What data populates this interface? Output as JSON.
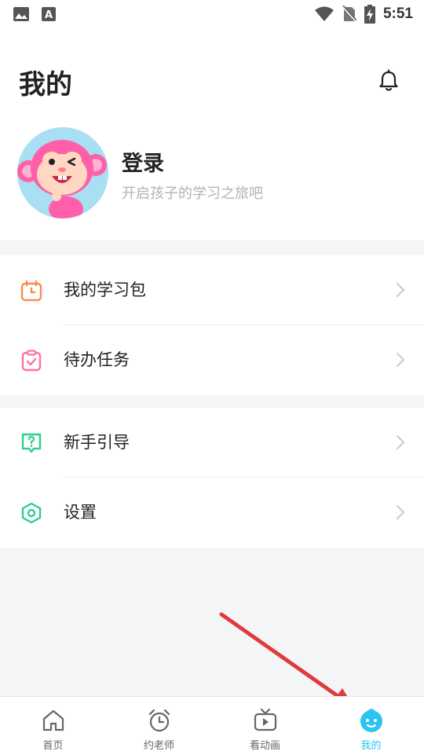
{
  "status_bar": {
    "time": "5:51",
    "left_icons": [
      "image-icon",
      "text-a-icon"
    ],
    "right_icons": [
      "wifi-icon",
      "no-sim-icon",
      "battery-charging-icon"
    ]
  },
  "header": {
    "title": "我的",
    "bell_icon": "bell-icon"
  },
  "profile": {
    "avatar": "monkey-avatar",
    "login_label": "登录",
    "subtitle": "开启孩子的学习之旅吧"
  },
  "menu_groups": [
    {
      "items": [
        {
          "label": "我的学习包",
          "icon": "calendar-clock-icon",
          "color": "#ff8a4c"
        },
        {
          "label": "待办任务",
          "icon": "clipboard-check-icon",
          "color": "#ff6fa3"
        }
      ]
    },
    {
      "items": [
        {
          "label": "新手引导",
          "icon": "help-chat-icon",
          "color": "#2ecf8e"
        },
        {
          "label": "设置",
          "icon": "settings-hexagon-icon",
          "color": "#2ecf8e"
        }
      ]
    }
  ],
  "tabbar": {
    "tabs": [
      {
        "label": "首页",
        "icon": "home-icon",
        "active": false
      },
      {
        "label": "约老师",
        "icon": "alarm-clock-icon",
        "active": false
      },
      {
        "label": "看动画",
        "icon": "tv-play-icon",
        "active": false
      },
      {
        "label": "我的",
        "icon": "baby-face-icon",
        "active": true
      }
    ],
    "active_color": "#2cc4f2",
    "inactive_color": "#666666"
  },
  "annotation": {
    "arrow_color": "#e03a3a"
  }
}
